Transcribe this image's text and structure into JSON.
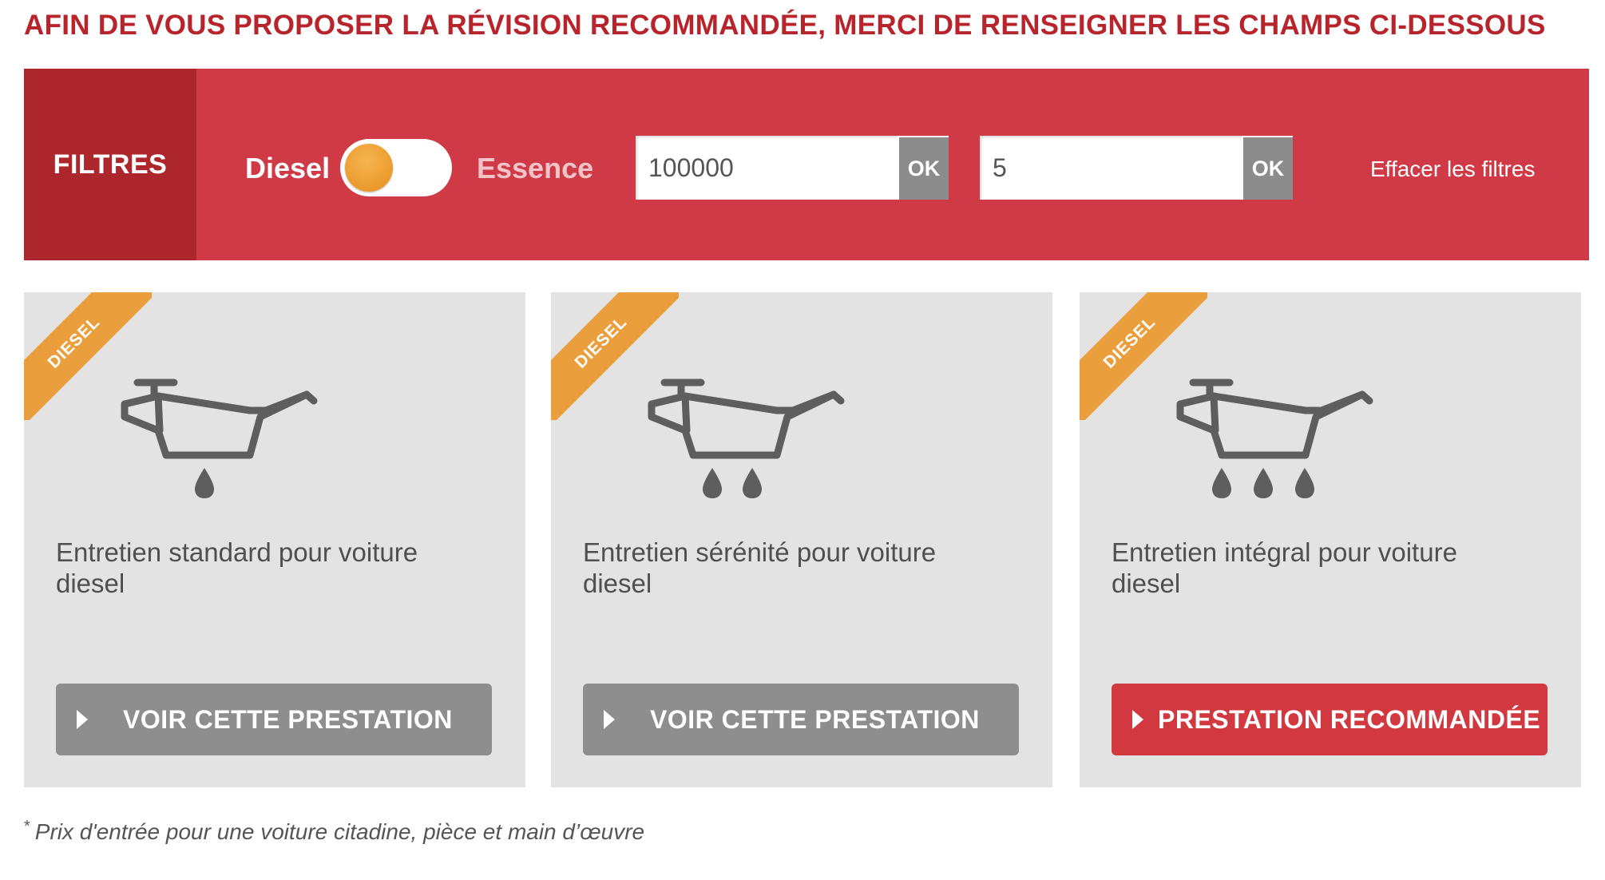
{
  "heading": "AFIN DE VOUS PROPOSER LA RÉVISION RECOMMANDÉE, MERCI DE RENSEIGNER LES CHAMPS CI-DESSOUS",
  "filters": {
    "label": "FILTRES",
    "fuel_left": "Diesel",
    "fuel_right": "Essence",
    "toggle_selected": "Diesel",
    "mileage_value": "100000",
    "age_value": "5",
    "ok_label": "OK",
    "clear_label": "Effacer les filtres"
  },
  "cards": [
    {
      "badge": "DIESEL",
      "icon": "oil-can-1-drop-icon",
      "drops": 1,
      "title": "Entretien standard pour voiture diesel",
      "button": "VOIR CETTE PRESTATION",
      "recommended": false
    },
    {
      "badge": "DIESEL",
      "icon": "oil-can-2-drops-icon",
      "drops": 2,
      "title": "Entretien sérénité pour voiture diesel",
      "button": "VOIR CETTE PRESTATION",
      "recommended": false
    },
    {
      "badge": "DIESEL",
      "icon": "oil-can-3-drops-icon",
      "drops": 3,
      "title": "Entretien intégral pour voiture diesel",
      "button": "PRESTATION RECOMMANDÉE",
      "recommended": true
    }
  ],
  "footnote": {
    "marker": "*",
    "text": "Prix d'entrée pour une voiture citadine, pièce et main d’œuvre"
  },
  "colors": {
    "heading": "#b8242c",
    "filter_bar": "#cf3a46",
    "filter_label_bg": "#ad262b",
    "badge": "#eb9f3c",
    "button_grey": "#8e8e8e",
    "button_recommended": "#d2383f"
  }
}
